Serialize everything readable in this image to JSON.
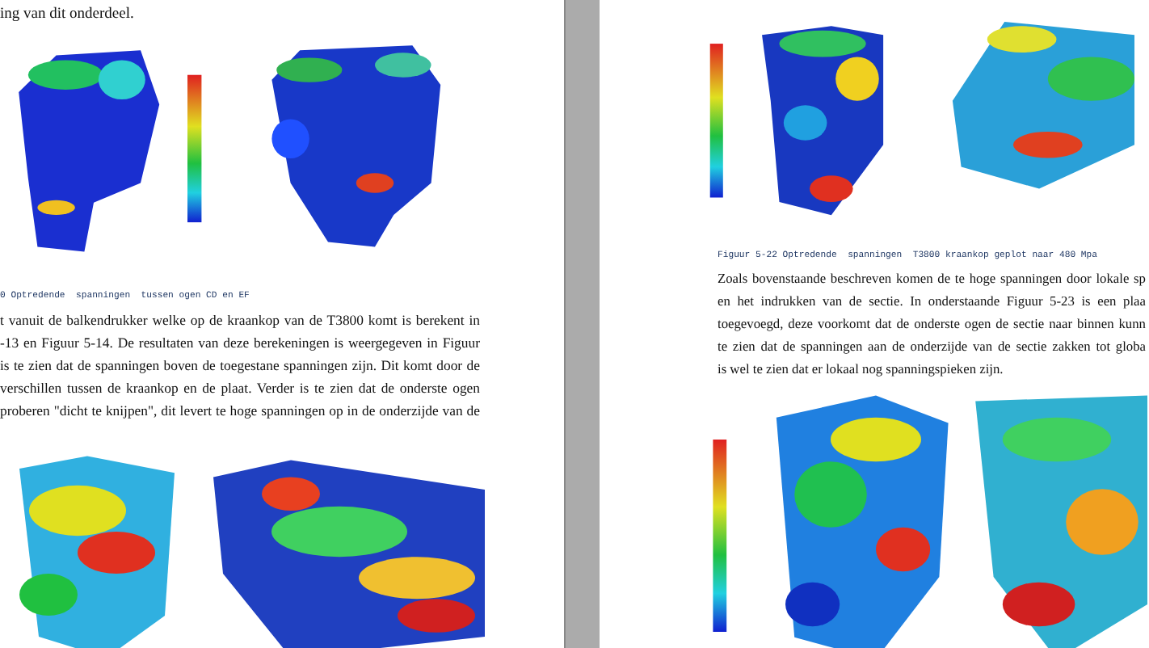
{
  "pages": [
    {
      "intro": "ing van dit onderdeel.",
      "caption": "0 Optredende  spanningen  tussen ogen CD en EF",
      "paragraph": [
        "t vanuit de balkendrukker welke op de kraankop van de T3800 komt is berekent in",
        "-13 en Figuur 5-14. De resultaten van deze berekeningen is weergegeven in Figuur",
        "is te zien dat de spanningen boven de toegestane spanningen zijn. Dit komt door de",
        "verschillen tussen de kraankop en de plaat. Verder is te zien dat de onderste ogen",
        "proberen \"dicht te knijpen\", dit levert te hoge spanningen op in de onderzijde van de"
      ]
    },
    {
      "caption": "Figuur 5-22 Optredende  spanningen  T3800 kraankop geplot naar 480 Mpa",
      "paragraph": [
        "Zoals bovenstaande beschreven komen de te hoge spanningen door lokale sp",
        "en het indrukken van de sectie. In onderstaande Figuur 5-23 is een plaa",
        "toegevoegd, deze voorkomt dat de onderste ogen de sectie naar binnen kunn",
        "te zien dat de spanningen aan de onderzijde van de sectie zakken tot globa",
        "is wel te zien dat er lokaal nog spanningspieken zijn."
      ]
    }
  ]
}
